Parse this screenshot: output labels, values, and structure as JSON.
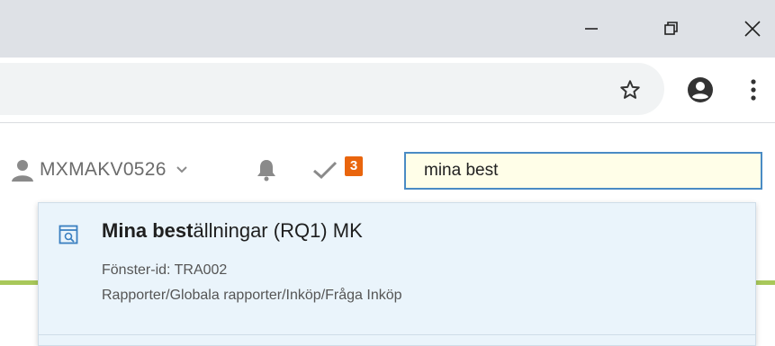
{
  "window": {
    "minimize_icon": "minimize-icon",
    "maximize_icon": "restore-icon",
    "close_icon": "close-icon"
  },
  "toolbar": {
    "bookmark_icon": "star-icon",
    "profile_icon": "account-icon",
    "menu_icon": "more-vertical-icon"
  },
  "header": {
    "username": "MXMAKV0526",
    "task_count": "3",
    "search": {
      "value": "mina best",
      "placeholder": ""
    }
  },
  "search_results": [
    {
      "title_match": "Mina best",
      "title_rest": "ällningar (RQ1) MK",
      "window_id": "Fönster-id: TRA002",
      "path": "Rapporter/Globala rapporter/Inköp/Fråga Inköp"
    }
  ],
  "colors": {
    "accent": "#4a8bc4",
    "badge": "#e9650d",
    "result_bg": "#eaf4fb",
    "green_bar": "#a8c85a"
  }
}
